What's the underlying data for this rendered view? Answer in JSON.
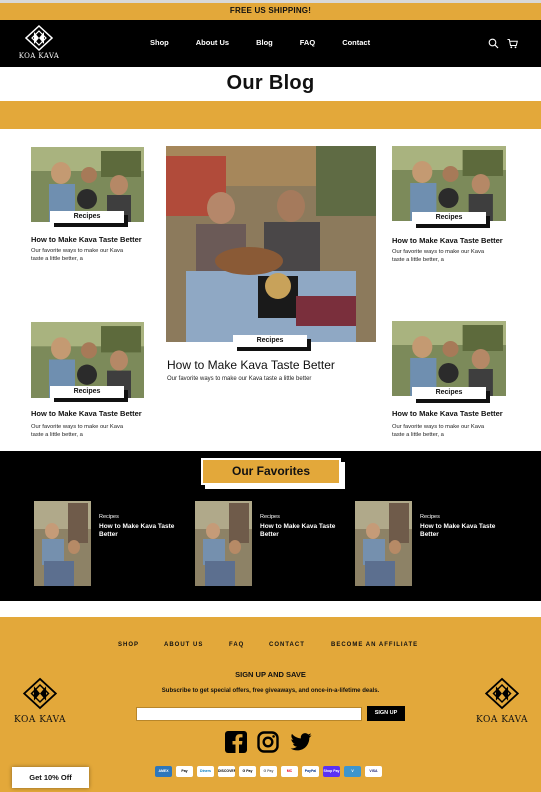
{
  "announcement": "FREE US SHIPPING!",
  "brand": {
    "name": "KOA KAVA",
    "logo_icon": "koa-kava-diamond-mark"
  },
  "nav": {
    "items": [
      "Shop",
      "About Us",
      "Blog",
      "FAQ",
      "Contact"
    ],
    "search_icon": "search-icon",
    "cart_icon": "cart-icon"
  },
  "page": {
    "title": "Our Blog"
  },
  "posts": [
    {
      "tag": "Recipes",
      "title": "How to Make Kava Taste Better",
      "excerpt": "Our favorite ways to make our Kava taste a little better, a"
    },
    {
      "tag": "Recipes",
      "title": "How to Make Kava Taste Better",
      "excerpt": "Our favorite ways to make our Kava taste a little better, a"
    },
    {
      "tag": "Recipes",
      "title": "How to Make Kava Taste Better",
      "excerpt": "Our favorite ways to make our Kava taste a little better, a"
    },
    {
      "tag": "Recipes",
      "title": "How to Make Kava Taste Better",
      "excerpt": "Our favorite ways to make our Kava taste a little better, a"
    }
  ],
  "featured": {
    "tag": "Recipes",
    "title": "How to Make Kava Taste Better",
    "excerpt": "Our favorite ways to make our Kava taste a little better"
  },
  "favorites": {
    "title": "Our Favorites",
    "items": [
      {
        "category": "Recipes",
        "title": "How to Make Kava Taste Better"
      },
      {
        "category": "Recipes",
        "title": "How to Make Kava Taste Better"
      },
      {
        "category": "Recipes",
        "title": "How to Make Kava Taste Better"
      }
    ]
  },
  "footer": {
    "links": [
      "SHOP",
      "ABOUT US",
      "FAQ",
      "CONTACT",
      "BECOME AN AFFILIATE"
    ],
    "signup_heading": "SIGN UP AND SAVE",
    "signup_text": "Subscribe to get special offers, free giveaways, and once-in-a-lifetime deals.",
    "email_placeholder": "",
    "signup_button": "SIGN UP",
    "social": [
      "facebook-icon",
      "instagram-icon",
      "twitter-icon"
    ],
    "payments": [
      "AMEX",
      "Pay",
      "Diners",
      "DISCOVER",
      "G Pay",
      "G Pay",
      "MC",
      "PayPal",
      "Shop Pay",
      "V",
      "VISA"
    ]
  },
  "discount_popup": "Get 10% Off",
  "colors": {
    "accent": "#e3a83a",
    "dark": "#000000",
    "light": "#ffffff"
  }
}
